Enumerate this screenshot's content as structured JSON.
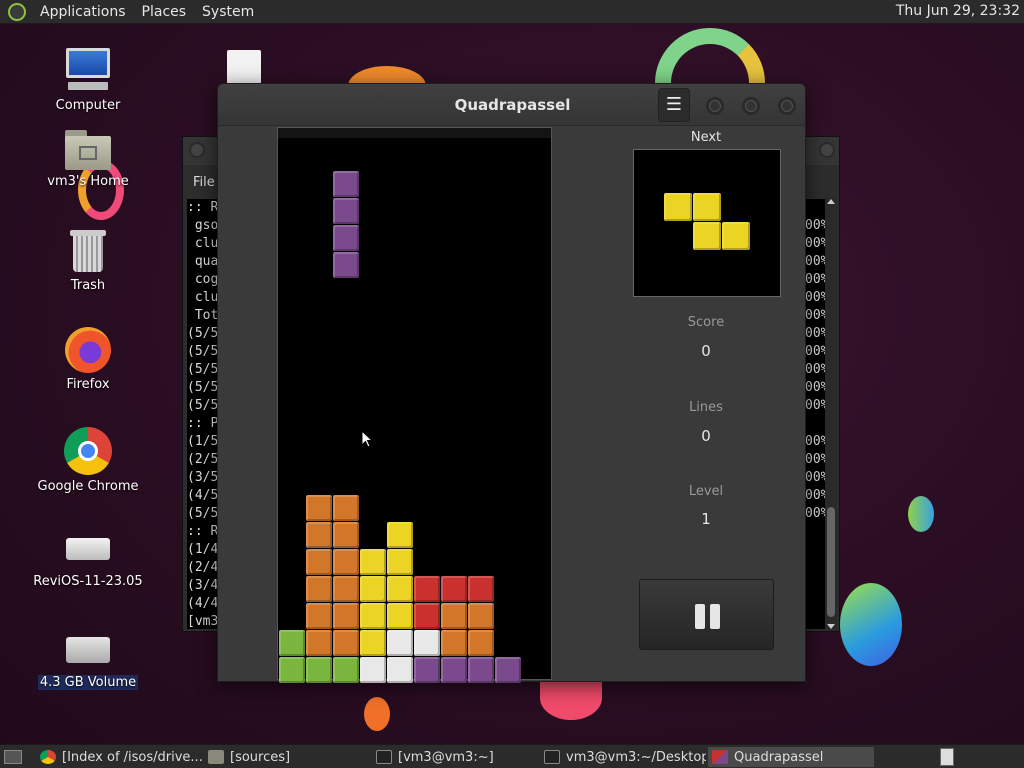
{
  "top_panel": {
    "menus": [
      "Applications",
      "Places",
      "System"
    ],
    "clock": "Thu Jun 29, 23:32"
  },
  "desktop_icons": [
    {
      "label": "Computer",
      "icon": "computer-icon"
    },
    {
      "label": "vm3's Home",
      "icon": "home-folder-icon"
    },
    {
      "label": "Trash",
      "icon": "trash-icon"
    },
    {
      "label": "Firefox",
      "icon": "firefox-icon"
    },
    {
      "label": "Google Chrome",
      "icon": "chrome-icon"
    },
    {
      "label": "ReviOS-11-23.05",
      "icon": "drive-icon"
    },
    {
      "label": "4.3 GB Volume",
      "icon": "drive-icon"
    }
  ],
  "terminal": {
    "menu_file": "File",
    "lines": [
      ":: R",
      " gso",
      " clu",
      " qua",
      " cog",
      " clu",
      " Tot",
      "(5/5",
      "(5/5",
      "(5/5",
      "(5/5",
      "(5/5",
      ":: P",
      "(1/5",
      "(2/5",
      "(3/5",
      "(4/5",
      "(5/5",
      ":: R",
      "(1/4",
      "(2/4",
      "(3/4",
      "(4/4",
      "[vm3"
    ],
    "right_column": [
      "",
      "00%",
      "00%",
      "00%",
      "00%",
      "00%",
      "00%",
      "00%",
      "00%",
      "00%",
      "00%",
      "00%",
      "",
      "00%",
      "00%",
      "00%",
      "00%",
      "00%",
      "",
      "",
      "",
      "",
      "",
      ""
    ]
  },
  "game": {
    "title": "Quadrapassel",
    "menu_icon": "hamburger-menu-icon",
    "next_label": "Next",
    "score_label": "Score",
    "score": "0",
    "lines_label": "Lines",
    "lines": "0",
    "level_label": "Level",
    "level": "1",
    "pause_icon": "pause-icon",
    "colors": {
      "purple": "#7a4a8c",
      "orange": "#d2772a",
      "yellow": "#ebd423",
      "red": "#c8312d",
      "green": "#7ab53e",
      "white": "#e8e8e8"
    },
    "falling_piece": {
      "color": "purple",
      "cells": [
        [
          2,
          1
        ],
        [
          2,
          2
        ],
        [
          2,
          3
        ],
        [
          2,
          4
        ]
      ]
    },
    "stack": [
      {
        "color": "orange",
        "cells": [
          [
            1,
            13
          ],
          [
            2,
            13
          ],
          [
            1,
            14
          ],
          [
            2,
            14
          ],
          [
            1,
            15
          ],
          [
            2,
            15
          ],
          [
            1,
            16
          ],
          [
            2,
            16
          ],
          [
            1,
            17
          ],
          [
            2,
            17
          ],
          [
            1,
            18
          ],
          [
            2,
            18
          ]
        ]
      },
      {
        "color": "yellow",
        "cells": [
          [
            4,
            14
          ],
          [
            3,
            15
          ],
          [
            4,
            15
          ],
          [
            3,
            16
          ],
          [
            4,
            16
          ],
          [
            3,
            17
          ],
          [
            4,
            17
          ],
          [
            3,
            18
          ]
        ]
      },
      {
        "color": "red",
        "cells": [
          [
            5,
            16
          ],
          [
            6,
            16
          ],
          [
            7,
            16
          ],
          [
            5,
            17
          ]
        ]
      },
      {
        "color": "orange",
        "cells": [
          [
            6,
            17
          ],
          [
            7,
            17
          ],
          [
            6,
            18
          ],
          [
            7,
            18
          ]
        ]
      },
      {
        "color": "green",
        "cells": [
          [
            0,
            18
          ],
          [
            0,
            19
          ],
          [
            1,
            19
          ],
          [
            2,
            19
          ]
        ]
      },
      {
        "color": "white",
        "cells": [
          [
            4,
            18
          ],
          [
            5,
            18
          ],
          [
            3,
            19
          ],
          [
            4,
            19
          ]
        ]
      },
      {
        "color": "purple",
        "cells": [
          [
            5,
            19
          ],
          [
            6,
            19
          ],
          [
            7,
            19
          ],
          [
            8,
            19
          ]
        ]
      }
    ],
    "next_piece": {
      "color": "yellow",
      "cells": [
        [
          0,
          0
        ],
        [
          1,
          0
        ],
        [
          1,
          1
        ],
        [
          2,
          1
        ]
      ]
    }
  },
  "taskbar": {
    "items": [
      {
        "label": "[Index of /isos/drive...",
        "icon": "chrome-icon"
      },
      {
        "label": "[sources]",
        "icon": "folder-icon"
      },
      {
        "label": "[vm3@vm3:~]",
        "icon": "terminal-icon"
      },
      {
        "label": "vm3@vm3:~/Desktop",
        "icon": "terminal-icon"
      },
      {
        "label": "Quadrapassel",
        "icon": "quadrapassel-icon"
      }
    ]
  }
}
